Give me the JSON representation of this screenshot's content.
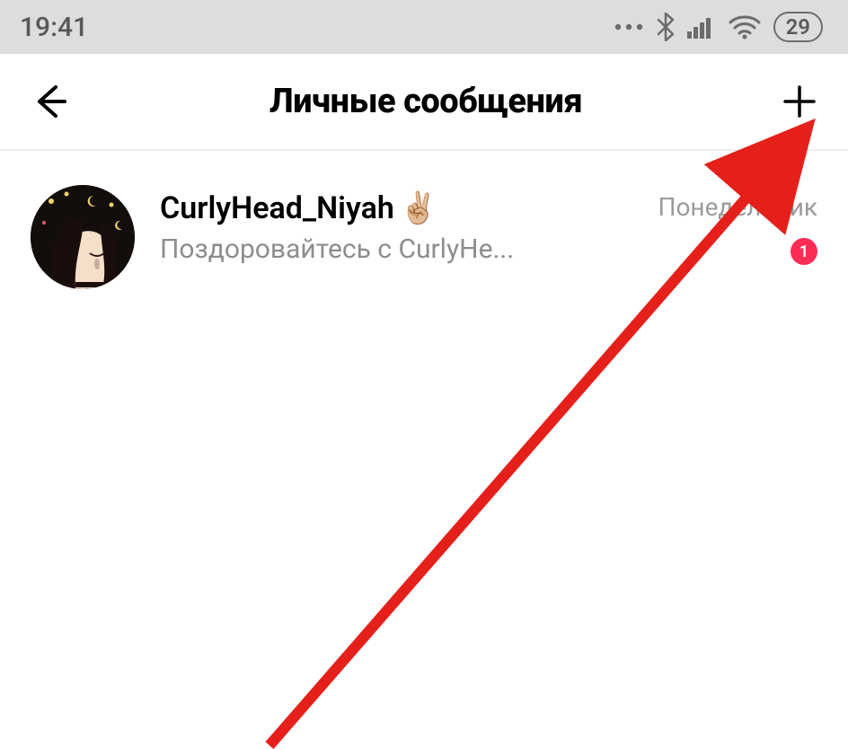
{
  "status": {
    "time": "19:41",
    "battery": "29"
  },
  "header": {
    "title": "Личные сообщения"
  },
  "chats": [
    {
      "username": "CurlyHead_Niyah",
      "emoji": "✌🏼",
      "preview": "Поздоровайтесь с CurlyHe...",
      "time": "Понедельник",
      "unread": "1"
    }
  ],
  "colors": {
    "accent": "#fe2c55",
    "arrow": "#e5201b"
  }
}
